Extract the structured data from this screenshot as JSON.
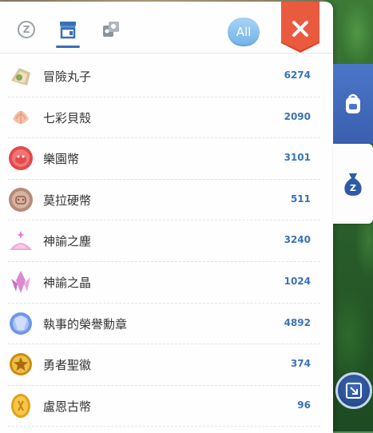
{
  "tabs": [
    {
      "name": "zeny",
      "glyph": "Z"
    },
    {
      "name": "shop"
    },
    {
      "name": "trade"
    }
  ],
  "filter_label": "All",
  "items": [
    {
      "name": "冒險丸子",
      "count": "6274"
    },
    {
      "name": "七彩貝殼",
      "count": "2090"
    },
    {
      "name": "樂園幣",
      "count": "3101"
    },
    {
      "name": "莫拉硬幣",
      "count": "511"
    },
    {
      "name": "神諭之塵",
      "count": "3240"
    },
    {
      "name": "神諭之晶",
      "count": "1024"
    },
    {
      "name": "執事的榮譽勳章",
      "count": "4892"
    },
    {
      "name": "勇者聖徽",
      "count": "374"
    },
    {
      "name": "盧恩古幣",
      "count": "96"
    }
  ],
  "side_bag_glyph": "Z",
  "colors": {
    "count": "#3b73b4",
    "accent": "#3b6fb6",
    "close": "#e0442f"
  }
}
